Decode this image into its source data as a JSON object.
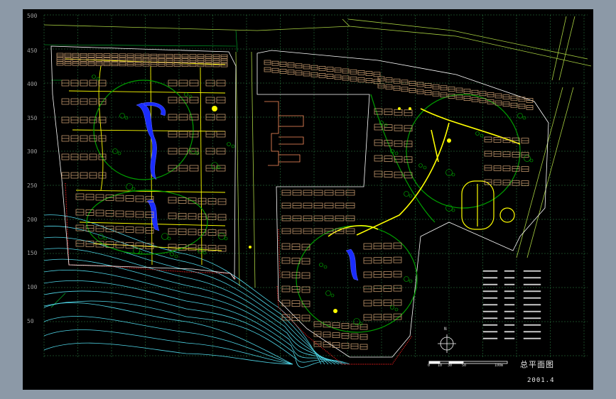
{
  "drawing": {
    "title": "总平面图",
    "date": "2001.4",
    "north_label": "N",
    "scale_labels": [
      "0",
      "10",
      "30",
      "50",
      "100m"
    ]
  },
  "y_axis_labels": [
    "500",
    "450",
    "400",
    "350",
    "300",
    "250",
    "200",
    "150",
    "100",
    "50"
  ],
  "colors": {
    "background": "#000000",
    "window": "#8c99a7",
    "grid": "#3fae5a",
    "buildings": "#d8a878",
    "roads": "#ffff00",
    "green": "#00a000",
    "water": "#1a2cff",
    "contours": "#4fd6e8",
    "boundary": "#ff2020",
    "site_lines": "#00c030"
  }
}
